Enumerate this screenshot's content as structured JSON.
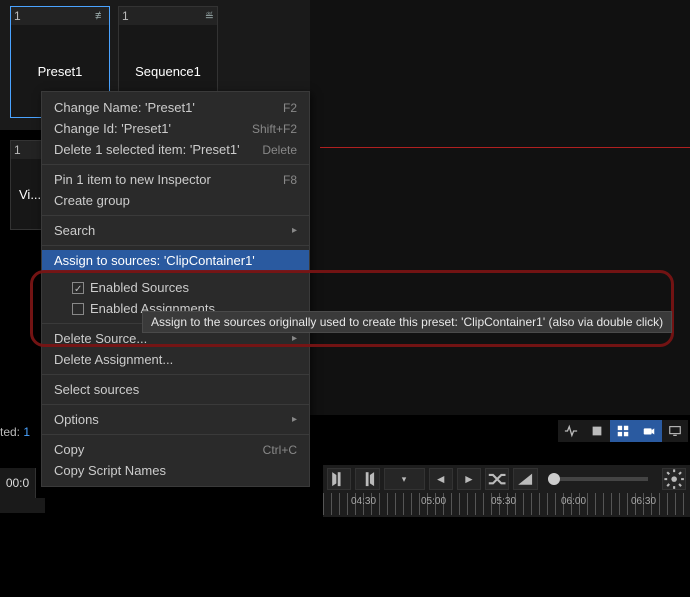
{
  "tiles": [
    {
      "num": "1",
      "label": "Preset1",
      "icon": "≢",
      "selected": true
    },
    {
      "num": "1",
      "label": "Sequence1",
      "icon": "≝",
      "selected": false
    }
  ],
  "row2_tile": {
    "num": "1",
    "label": "Vi..."
  },
  "menu": {
    "change_name": "Change Name: 'Preset1'",
    "change_name_sc": "F2",
    "change_id": "Change Id: 'Preset1'",
    "change_id_sc": "Shift+F2",
    "delete_sel": "Delete 1 selected item: 'Preset1'",
    "delete_sel_sc": "Delete",
    "pin": "Pin 1 item to new Inspector",
    "pin_sc": "F8",
    "create_group": "Create group",
    "search": "Search",
    "assign": "Assign to sources: 'ClipContainer1'",
    "enabled_sources": "Enabled Sources",
    "enabled_assignments": "Enabled Assignments",
    "delete_source": "Delete Source...",
    "delete_assignment": "Delete Assignment...",
    "select_sources": "Select sources",
    "options": "Options",
    "copy": "Copy",
    "copy_sc": "Ctrl+C",
    "copy_script": "Copy Script Names"
  },
  "tooltip": "Assign to the sources originally used to create this preset: 'ClipContainer1' (also via double click)",
  "status": {
    "prefix": "ted:",
    "value": "1"
  },
  "timecode": "00:0",
  "ruler_ticks": [
    "04:30",
    "05:00",
    "05:30",
    "06:00",
    "06:30"
  ],
  "toolbar_icons": [
    "activity",
    "square",
    "grid",
    "camera",
    "monitor"
  ],
  "timeline_icons": [
    "in-mark",
    "out-mark",
    "dropdown",
    "prev",
    "next",
    "shuffle",
    "contrast",
    "gear"
  ]
}
